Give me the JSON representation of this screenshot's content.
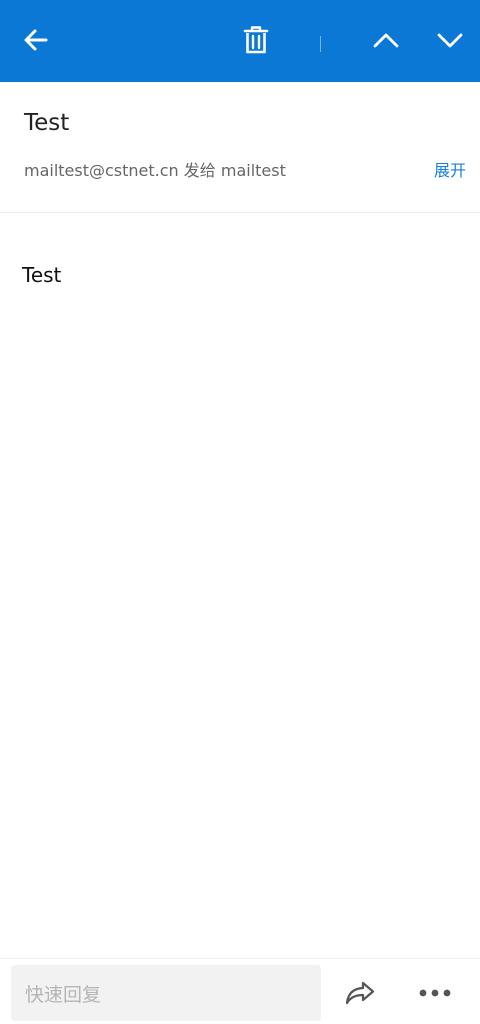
{
  "topbar": {
    "background": "#0a78d4",
    "icons": {
      "back": "arrow-left-icon",
      "delete": "trash-icon",
      "prev": "chevron-up-icon",
      "next": "chevron-down-icon"
    }
  },
  "mail": {
    "subject": "Test",
    "sender_line": "mailtest@cstnet.cn 发给 mailtest",
    "expand_label": "展开",
    "body": "Test"
  },
  "bottombar": {
    "quick_reply_placeholder": "快速回复",
    "icons": {
      "forward": "forward-arrow-icon",
      "more": "more-dots-icon"
    }
  },
  "colors": {
    "accent": "#1a7fd6",
    "topbar": "#0a78d4"
  }
}
